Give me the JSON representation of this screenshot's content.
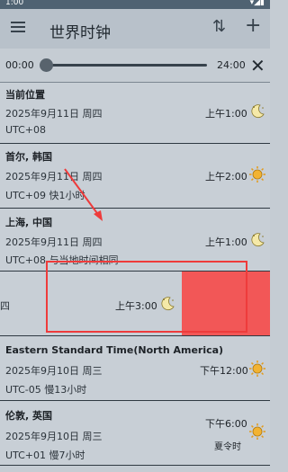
{
  "status_bar": {
    "time": "1:00",
    "icons": "▾◢▮"
  },
  "app_bar": {
    "title": "世界时钟",
    "menu_icon": "menu-icon",
    "sort_icon": "⇅",
    "add_icon": "+"
  },
  "slider": {
    "start": "00:00",
    "end": "24:00",
    "value_fraction": 0.0,
    "close_icon": "✕"
  },
  "clocks": [
    {
      "name": "当前位置",
      "date": "2025年9月11日 周四",
      "offset": "UTC+08",
      "time": "上午1:00",
      "icon": "moon-night-icon"
    },
    {
      "name": "首尔, 韩国",
      "date": "2025年9月11日 周四",
      "offset": "UTC+09  快1小时",
      "time": "上午2:00",
      "icon": "sun-icon"
    },
    {
      "name": "上海, 中国",
      "date": "2025年9月11日 周四",
      "offset": "UTC+08  与当地时间相同",
      "time": "上午1:00",
      "icon": "moon-night-icon"
    },
    {
      "name": "",
      "date": "",
      "offset": "",
      "partial": "四",
      "time": "上午3:00",
      "icon": "moon-night-icon"
    },
    {
      "name": "Eastern Standard Time(North America)",
      "date": "2025年9月10日 周三",
      "offset": "UTC-05  慢13小时",
      "time": "下午12:00",
      "icon": "sun-icon"
    },
    {
      "name": "伦敦, 英国",
      "date": "2025年9月10日 周三",
      "offset": "UTC+01  慢7小时",
      "time": "下午6:00",
      "sub": "夏令时",
      "icon": "sun-icon"
    }
  ],
  "colors": {
    "highlight": "#ee3b3b",
    "delete_zone": "#f25757",
    "app_bar": "#b8c1ca"
  }
}
